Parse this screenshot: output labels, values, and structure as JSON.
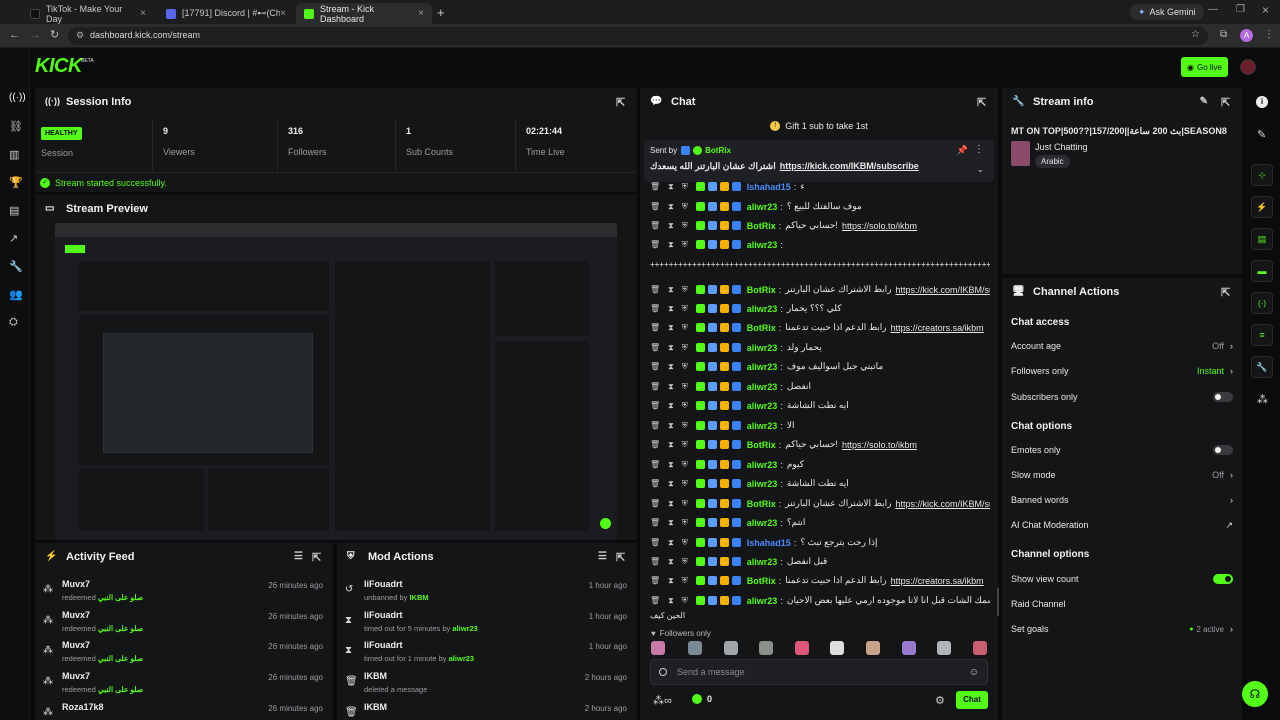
{
  "browser": {
    "tabs": [
      {
        "title": "TikTok - Make Your Day"
      },
      {
        "title": "[17791] Discord | #⊷(Chat) | ..."
      },
      {
        "title": "Stream - Kick Dashboard"
      }
    ],
    "ask_gemini": "Ask Gemini",
    "url": "dashboard.kick.com/stream",
    "profile_initial": "A"
  },
  "header": {
    "logo": "KICK",
    "logo_badge": "BETA",
    "go_live": "Go live"
  },
  "session_info": {
    "title": "Session Info",
    "health": "HEALTHY",
    "session_label": "Session",
    "stats": [
      {
        "value": "9",
        "label": "Viewers"
      },
      {
        "value": "316",
        "label": "Followers"
      },
      {
        "value": "1",
        "label": "Sub Counts"
      },
      {
        "value": "02:21:44",
        "label": "Time Live"
      }
    ],
    "status_message": "Stream started successfully."
  },
  "stream_preview": {
    "title": "Stream Preview"
  },
  "activity_feed": {
    "title": "Activity Feed",
    "items": [
      {
        "user": "Muvx7",
        "action": "redeemed",
        "reward": "صلو على النبي",
        "time": "26 minutes ago"
      },
      {
        "user": "Muvx7",
        "action": "redeemed",
        "reward": "صلو على النبي",
        "time": "26 minutes ago"
      },
      {
        "user": "Muvx7",
        "action": "redeemed",
        "reward": "صلو على النبي",
        "time": "26 minutes ago"
      },
      {
        "user": "Muvx7",
        "action": "redeemed",
        "reward": "صلو على النبي",
        "time": "26 minutes ago"
      },
      {
        "user": "Roza17k8",
        "action": "",
        "reward": "",
        "time": "26 minutes ago"
      }
    ]
  },
  "mod_actions": {
    "title": "Mod Actions",
    "items": [
      {
        "user": "IiFouadrt",
        "action": "unbanned by",
        "target": "IKBM",
        "time": "1 hour ago"
      },
      {
        "user": "IiFouadrt",
        "action": "timed out for 5 minutes by",
        "target": "aliwr23",
        "time": "1 hour ago"
      },
      {
        "user": "IiFouadrt",
        "action": "timed out for 1 minute by",
        "target": "aliwr23",
        "time": "1 hour ago"
      },
      {
        "user": "IKBM",
        "action": "deleted a message",
        "target": "",
        "time": "2 hours ago"
      },
      {
        "user": "IKBM",
        "action": "",
        "target": "",
        "time": "2 hours ago"
      }
    ]
  },
  "chat": {
    "title": "Chat",
    "gift_banner": "Gift 1 sub to take 1st",
    "pinned": {
      "sent_by": "Sent by",
      "user": "BotRix",
      "text": "اشتراك عشان البارتنر الله يسعدك",
      "link": "https://kick.com/IKBM/subscribe"
    },
    "messages": [
      {
        "user": "Ishahad15",
        "color": "#4a8cff",
        "text": "ء",
        "link": ""
      },
      {
        "user": "aliwr23",
        "color": "#53fc18",
        "text": "موف سالفتك للبيع ؟",
        "link": ""
      },
      {
        "user": "BotRix",
        "color": "#53fc18",
        "text": "!حسابي حياكم",
        "link": "https://solo.to/ikbm"
      },
      {
        "user": "aliwr23",
        "color": "#53fc18",
        "text": "",
        "link": ""
      },
      {
        "user": "",
        "color": "#ffffff",
        "text": "++++++++++++++++++++++++++++++++++++++++++++++++++++++++++++++++++++++++++++++",
        "link": ""
      },
      {
        "user": "BotRix",
        "color": "#53fc18",
        "text": "رابط الاشتراك عشان البارتنر",
        "link": "https://kick.com/IKBM/subscribe"
      },
      {
        "user": "aliwr23",
        "color": "#53fc18",
        "text": "كلي ؟؟؟ يحمار",
        "link": ""
      },
      {
        "user": "BotRix",
        "color": "#53fc18",
        "text": "رابط الدعم اذا حبيت تدعمنا",
        "link": "https://creators.sa/ikbm"
      },
      {
        "user": "aliwr23",
        "color": "#53fc18",
        "text": "يحمار ولد",
        "link": ""
      },
      {
        "user": "aliwr23",
        "color": "#53fc18",
        "text": "ماتبني جبل اسواليف موف",
        "link": ""
      },
      {
        "user": "aliwr23",
        "color": "#53fc18",
        "text": "انفصل",
        "link": ""
      },
      {
        "user": "aliwr23",
        "color": "#53fc18",
        "text": "ايه نطت الشاشة",
        "link": ""
      },
      {
        "user": "aliwr23",
        "color": "#53fc18",
        "text": "الا",
        "link": ""
      },
      {
        "user": "BotRix",
        "color": "#53fc18",
        "text": "!حسابي حياكم",
        "link": "https://solo.to/ikbm"
      },
      {
        "user": "aliwr23",
        "color": "#53fc18",
        "text": "كيوم",
        "link": ""
      },
      {
        "user": "aliwr23",
        "color": "#53fc18",
        "text": "ايه نطت الشاشة",
        "link": ""
      },
      {
        "user": "BotRix",
        "color": "#53fc18",
        "text": "رابط الاشتراك عشان البارتنر",
        "link": "https://kick.com/IKBM/subscribe"
      },
      {
        "user": "aliwr23",
        "color": "#53fc18",
        "text": "انتم؟",
        "link": ""
      },
      {
        "user": "Ishahad15",
        "color": "#4a8cff",
        "text": "إذا رحت بترجع تبث ؟",
        "link": ""
      },
      {
        "user": "aliwr23",
        "color": "#53fc18",
        "text": "قبل انفصل",
        "link": ""
      },
      {
        "user": "BotRix",
        "color": "#53fc18",
        "text": "رابط الدعم اذا حبيت تدعمنا",
        "link": "https://creators.sa/ikbm"
      },
      {
        "user": "aliwr23",
        "color": "#53fc18",
        "text": "قبل البث ماتبني جبل اسمك الشات قبل انا لانا موجوده ارمي عليها بعض الاحيان",
        "link": ""
      },
      {
        "user": "",
        "color": "#ffffff",
        "text": "الحين كيف",
        "link": ""
      }
    ],
    "followers_only": "Followers only",
    "input_placeholder": "Send a message",
    "footer_count": "0",
    "chat_button": "Chat"
  },
  "stream_info": {
    "title": "Stream info",
    "stream_title": "MT ON TOP|500??|157/200||بث 200 ساعة|SEASON8",
    "category": "Just Chatting",
    "tag": "Arabic"
  },
  "channel_actions": {
    "title": "Channel Actions",
    "chat_access_heading": "Chat access",
    "account_age": {
      "label": "Account age",
      "value": "Off"
    },
    "followers_only": {
      "label": "Followers only",
      "value": "Instant"
    },
    "subscribers_only": {
      "label": "Subscribers only",
      "enabled": false
    },
    "chat_options_heading": "Chat options",
    "emotes_only": {
      "label": "Emotes only",
      "enabled": false
    },
    "slow_mode": {
      "label": "Slow mode",
      "value": "Off"
    },
    "banned_words": {
      "label": "Banned words"
    },
    "ai_moderation": {
      "label": "AI Chat Moderation"
    },
    "channel_options_heading": "Channel options",
    "show_view_count": {
      "label": "Show view count",
      "enabled": true
    },
    "raid_channel": {
      "label": "Raid Channel"
    },
    "set_goals": {
      "label": "Set goals",
      "value": "2 active"
    }
  },
  "colors": {
    "accent": "#53fc18",
    "panel": "#141517",
    "background": "#0a0b0c"
  }
}
